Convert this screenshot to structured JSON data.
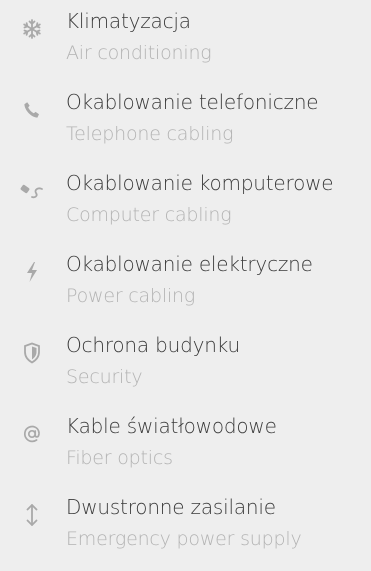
{
  "services": [
    {
      "title": "Klimatyzacja",
      "subtitle": "Air conditioning",
      "icon": "snowflake-icon"
    },
    {
      "title": "Okablowanie telefoniczne",
      "subtitle": "Telephone cabling",
      "icon": "phone-icon"
    },
    {
      "title": "Okablowanie komputerowe",
      "subtitle": "Computer cabling",
      "icon": "network-cable-icon"
    },
    {
      "title": "Okablowanie elektryczne",
      "subtitle": "Power cabling",
      "icon": "lightning-icon"
    },
    {
      "title": "Ochrona budynku",
      "subtitle": "Security",
      "icon": "shield-icon"
    },
    {
      "title": "Kable światłowodowe",
      "subtitle": "Fiber optics",
      "icon": "at-sign-icon"
    },
    {
      "title": "Dwustronne zasilanie",
      "subtitle": "Emergency power supply",
      "icon": "up-down-arrow-icon"
    }
  ],
  "colors": {
    "background": "#eeeeee",
    "title": "#3a3a3a",
    "subtitle": "#b3b3b3",
    "icon": "#a9a9a9"
  }
}
